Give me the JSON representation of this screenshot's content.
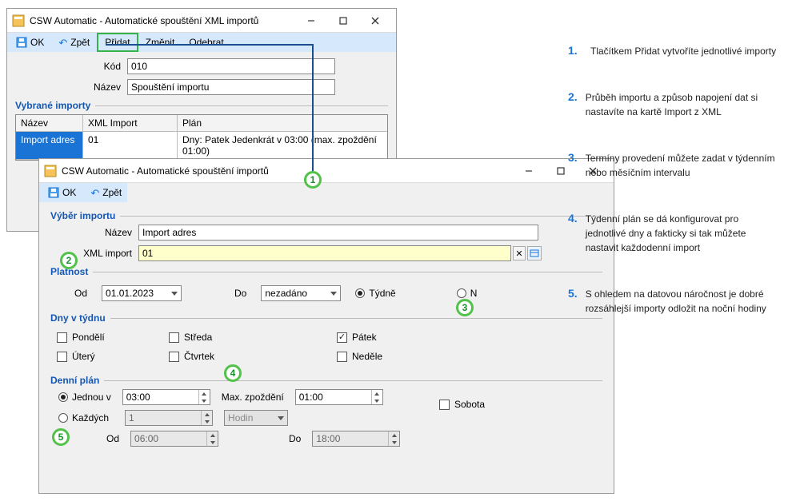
{
  "win1": {
    "title": "CSW Automatic - Automatické spouštění XML importů",
    "toolbar": {
      "ok": "OK",
      "back": "Zpět",
      "add": "Přidat",
      "edit": "Změnit",
      "remove": "Odebrat"
    },
    "fields": {
      "code_lbl": "Kód",
      "code_val": "010",
      "name_lbl": "Název",
      "name_val": "Spouštění importu"
    },
    "table": {
      "group": "Vybrané importy",
      "headers": {
        "name": "Název",
        "xml": "XML Import",
        "plan": "Plán"
      },
      "rows": [
        {
          "name": "Import adres",
          "xml": "01",
          "plan": "Dny: Patek Jedenkrát v 03:00 (max. zpoždění 01:00)"
        }
      ]
    }
  },
  "win2": {
    "title": "CSW Automatic - Automatické spouštění importů",
    "toolbar": {
      "ok": "OK",
      "back": "Zpět"
    },
    "select_group": "Výběr importu",
    "name_lbl": "Název",
    "name_val": "Import adres",
    "xml_lbl": "XML import",
    "xml_val": "01",
    "validity_group": "Platnost",
    "from_lbl": "Od",
    "from_val": "01.01.2023",
    "to_lbl": "Do",
    "to_val": "nezadáno",
    "period_weekly": "Týdně",
    "period_monthlyish": "N",
    "days_group": "Dny v týdnu",
    "days": {
      "mon": "Pondělí",
      "tue": "Úterý",
      "wed": "Středa",
      "thu": "Čtvrtek",
      "fri": "Pátek",
      "sat": "Sobota",
      "sun": "Neděle"
    },
    "daily_group": "Denní plán",
    "once_lbl": "Jednou v",
    "once_val": "03:00",
    "maxdelay_lbl": "Max. zpoždění",
    "maxdelay_val": "01:00",
    "every_lbl": "Každých",
    "every_count": "1",
    "every_unit": "Hodin",
    "range_from_lbl": "Od",
    "range_from_val": "06:00",
    "range_to_lbl": "Do",
    "range_to_val": "18:00"
  },
  "annotations": [
    {
      "n": "1.",
      "t": "Tlačítkem Přidat vytvoříte jednotlivé importy"
    },
    {
      "n": "2.",
      "t": "Průběh importu a způsob napojení dat si nastavíte na kartě Import z XML"
    },
    {
      "n": "3.",
      "t": "Termíny provedení můžete zadat v týdenním nebo měsíčním intervalu"
    },
    {
      "n": "4.",
      "t": "Týdenní plán se dá konfigurovat pro jednotlivé dny a fakticky si tak můžete nastavit každodenní import"
    },
    {
      "n": "5.",
      "t": "S ohledem na datovou náročnost je dobré rozsáhlejší importy odložit na noční hodiny"
    }
  ]
}
